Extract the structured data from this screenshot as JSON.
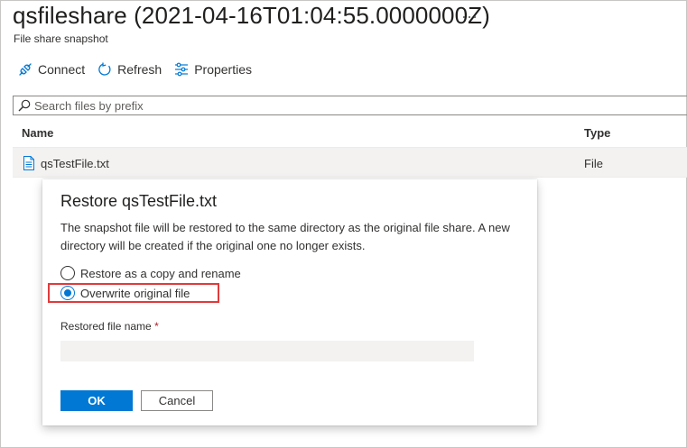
{
  "header": {
    "title": "qsfileshare (2021-04-16T01:04:55.0000000Z)",
    "more": "···",
    "subtitle": "File share snapshot"
  },
  "toolbar": {
    "connect": "Connect",
    "refresh": "Refresh",
    "properties": "Properties"
  },
  "search": {
    "placeholder": "Search files by prefix"
  },
  "table": {
    "columns": [
      "Name",
      "Type"
    ],
    "rows": [
      {
        "name": "qsTestFile.txt",
        "type": "File"
      }
    ]
  },
  "dialog": {
    "title": "Restore qsTestFile.txt",
    "description": "The snapshot file will be restored to the same directory as the original file share. A new directory will be created if the original one no longer exists.",
    "options": [
      {
        "label": "Restore as a copy and rename",
        "checked": false
      },
      {
        "label": "Overwrite original file",
        "checked": true
      }
    ],
    "field_label": "Restored file name",
    "required_mark": "*",
    "field_value": "",
    "ok_label": "OK",
    "cancel_label": "Cancel"
  },
  "colors": {
    "accent": "#0078d4",
    "highlight_border": "#e03b3b",
    "required": "#a4262c"
  }
}
